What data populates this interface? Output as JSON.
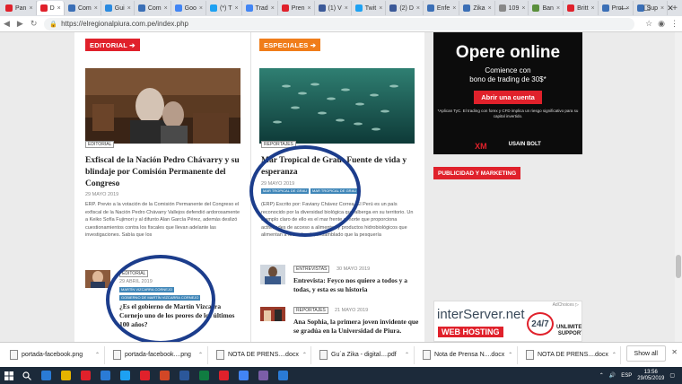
{
  "browser": {
    "tabs": [
      {
        "label": "Pan",
        "color": "#e0212b"
      },
      {
        "label": "D",
        "color": "#e0212b",
        "active": true
      },
      {
        "label": "Com",
        "color": "#3b6fb6"
      },
      {
        "label": "Gui",
        "color": "#2a8ae0"
      },
      {
        "label": "Com",
        "color": "#3b6fb6"
      },
      {
        "label": "Goo",
        "color": "#4285f4"
      },
      {
        "label": "(*) T",
        "color": "#1da1f2"
      },
      {
        "label": "Trad",
        "color": "#4285f4"
      },
      {
        "label": "Pren",
        "color": "#e0212b"
      },
      {
        "label": "(1) V",
        "color": "#3b5998"
      },
      {
        "label": "Twit",
        "color": "#1da1f2"
      },
      {
        "label": "(2) D",
        "color": "#3b5998"
      },
      {
        "label": "Enfe",
        "color": "#3b6fb6"
      },
      {
        "label": "Zika",
        "color": "#3b6fb6"
      },
      {
        "label": "109",
        "color": "#888888"
      },
      {
        "label": "Ban",
        "color": "#5a8f3c"
      },
      {
        "label": "Britt",
        "color": "#e0212b"
      },
      {
        "label": "Prot",
        "color": "#3b6fb6"
      },
      {
        "label": "Sup",
        "color": "#3b6fb6"
      }
    ],
    "url": "https://elregionalpiura.com.pe/index.php",
    "new_tab": "+",
    "win_min": "—",
    "win_max": "☐",
    "win_close": "✕"
  },
  "page": {
    "editorial_label": "EDITORIAL ➔",
    "especiales_label": "ESPECIALES ➔",
    "colors": {
      "editorial": "#e0212b",
      "especiales": "#f07d1a",
      "pill": "#3f86b8",
      "circle": "#1c3d8c"
    },
    "article1": {
      "tag": "EDITORIAL",
      "title": "Exfiscal de la Nación Pedro Chávarry y su blindaje por Comisión Permanente del Congreso",
      "date": "29 MAYO 2019",
      "excerpt": "ERP. Previo a la votación de la Comisión Permanente del Congreso el exfiscal de la Nación Pedro Chávarry Vallejos defendió ardorosamente a Keiko Sofía Fujimori y al difunto Alan García Pérez, además deslizó cuestionamientos contra los fiscales que llevan adelante las investigaciones. Sabía que los"
    },
    "article2": {
      "tag": "REPORTAJES",
      "title": "Mar Tropical de Grau: Fuente de vida y esperanza",
      "date": "29 MAYO 2019",
      "pills": [
        "MAR TROPICAL DE GRAU",
        "MAR TROPICAL DE GRAU"
      ],
      "excerpt": "(ERP) Escrito por: Faviany Chávez Correa. El Perú es un país reconocido por la diversidad biológica que alberga en su territorio. Un ejemplo claro de ello es el mar frente al norte que proporciona actividades de acceso a alimentos y productos hidrobiológicos que alimentan a todo el país, ensamblado que la pesquería"
    },
    "article3": {
      "tag": "EDITORIAL",
      "date": "29 ABRIL 2019",
      "pills": [
        "MARTÍN VIZCARRA CORNEJO",
        "GOBIERNO DE MARTÍN VIZCARRA CORNEJO"
      ],
      "title": "¿Es el gobierno de Martín Vizcarra Cornejo uno de los peores de los últimos 100 años?"
    },
    "list": [
      {
        "tag": "ENTREVISTAS",
        "date": "30 MAYO 2019",
        "title": "Entrevista: Feyco nos quiere a todos y a todas, y esta es su historia"
      },
      {
        "tag": "REPORTAJES",
        "date": "21 MAYO 2019",
        "title": "Ana Sophia, la primera joven invidente que se gradúa en la Universidad de Piura."
      }
    ],
    "ad_xm": {
      "headline": "Opere online",
      "sub1": "Comience con",
      "sub2": "bono de trading de 30$*",
      "button": "Abrir una cuenta",
      "fine": "*Aplican TyC. El trading con forex y CFD implica un riesgo significativo para su capital invertido.",
      "logo1": "XM",
      "logo2": "USAIN BOLT"
    },
    "publicidad_label": "PUBLICIDAD Y MARKETING",
    "ad_interserver": {
      "brand": "interServer.net",
      "web_hosting": "WEB HOSTING",
      "badge": "24/7",
      "unlimited": "UNLIMITED SUPPORT",
      "adchoices": "AdChoices ▷"
    }
  },
  "downloads": {
    "items": [
      "portada-facebook.png",
      "portada-facebook....png",
      "NOTA DE PRENS....docx",
      "Gu´a Zika - digital....pdf",
      "Nota de Prensa N....docx",
      "NOTA DE PRENS....docx"
    ],
    "show_all": "Show all",
    "close": "✕"
  },
  "taskbar": {
    "lang": "ESP",
    "time": "13:56",
    "date": "29/05/2019",
    "apps": [
      "#2a7bd6",
      "#e6b400",
      "#e0212b",
      "#2a7bd6",
      "#1da1f2",
      "#e0212b",
      "#d24726",
      "#2b579a",
      "#107c41",
      "#e0212b",
      "#4285f4",
      "#7b5ea7",
      "#2a7bd6"
    ]
  }
}
